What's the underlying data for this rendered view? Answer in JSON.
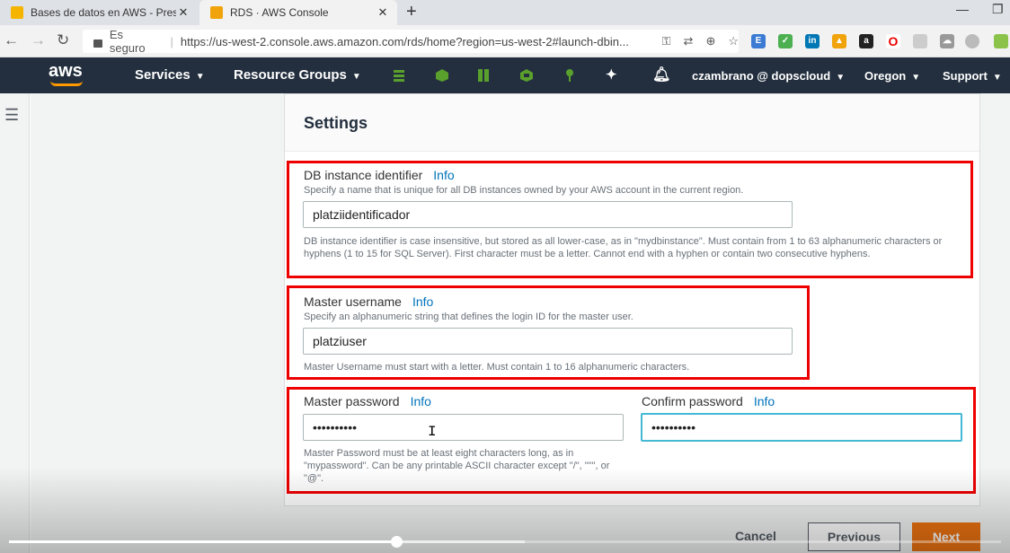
{
  "browser": {
    "tabs": [
      {
        "title": "Bases de datos en AWS - Present",
        "active": false,
        "favicon_color": "#f4b400"
      },
      {
        "title": "RDS · AWS Console",
        "active": true,
        "favicon_color": "#f0a30a"
      }
    ],
    "secure_label": "Es seguro",
    "url": "https://us-west-2.console.aws.amazon.com/rds/home?region=us-west-2#launch-dbin..."
  },
  "aws_nav": {
    "logo": "aws",
    "services": "Services",
    "resource_groups": "Resource Groups",
    "account": "czambrano @ dopscloud",
    "region": "Oregon",
    "support": "Support",
    "pinned_color": "#5aa02c"
  },
  "settings": {
    "title": "Settings",
    "info_label": "Info",
    "db_identifier": {
      "label": "DB instance identifier",
      "description": "Specify a name that is unique for all DB instances owned by your AWS account in the current region.",
      "value": "platziidentificador",
      "help": "DB instance identifier is case insensitive, but stored as all lower-case, as in \"mydbinstance\". Must contain from 1 to 63 alphanumeric characters or hyphens (1 to 15 for SQL Server). First character must be a letter. Cannot end with a hyphen or contain two consecutive hyphens."
    },
    "master_username": {
      "label": "Master username",
      "description": "Specify an alphanumeric string that defines the login ID for the master user.",
      "value": "platziuser",
      "help": "Master Username must start with a letter. Must contain 1 to 16 alphanumeric characters."
    },
    "master_password": {
      "label": "Master password",
      "value": "••••••••••",
      "help": "Master Password must be at least eight characters long, as in \"mypassword\". Can be any printable ASCII character except \"/\", \"\"\", or \"@\"."
    },
    "confirm_password": {
      "label": "Confirm password",
      "value": "••••••••••"
    }
  },
  "footer": {
    "cancel": "Cancel",
    "previous": "Previous",
    "next": "Next"
  },
  "video_progress": 0.39
}
